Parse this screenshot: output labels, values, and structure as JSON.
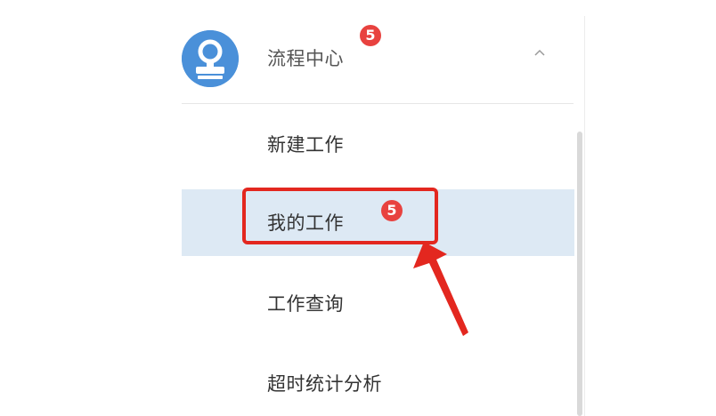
{
  "menu": {
    "header": {
      "label": "流程中心",
      "badge": "5",
      "avatar_icon": "user-stamp-icon",
      "chevron_icon": "chevron-up-icon"
    },
    "items": [
      {
        "label": "新建工作",
        "active": false
      },
      {
        "label": "我的工作",
        "badge": "5",
        "active": true
      },
      {
        "label": "工作查询",
        "active": false
      },
      {
        "label": "超时统计分析",
        "active": false
      }
    ]
  },
  "annotation": {
    "highlight_color": "#e3271f",
    "target": "我的工作"
  },
  "colors": {
    "accent": "#4a90d9",
    "badge": "#e8423f",
    "active_bg": "#dde9f4"
  }
}
